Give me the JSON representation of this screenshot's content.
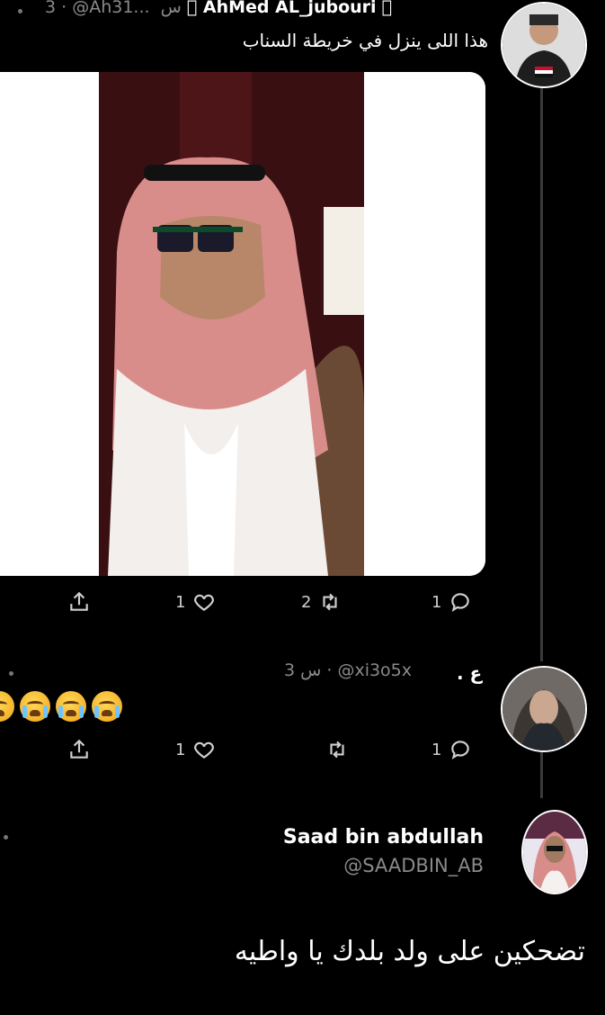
{
  "tweet1": {
    "time": "3 · @Ah31...  س",
    "apple_left": "",
    "name": "AhMed AL_jubouri",
    "apple_right": "",
    "text": "هذا اللى ينزل في خريطة السناب",
    "actions": {
      "share": "",
      "likes": "1",
      "retweets": "2",
      "replies": "1"
    }
  },
  "tweet2": {
    "time_handle": "س 3 · @xi3o5x",
    "name": "ع .",
    "emoji_count": 4,
    "actions": {
      "share": "",
      "likes": "1",
      "retweets": "",
      "replies": "1"
    }
  },
  "tweet3": {
    "name": "Saad bin abdullah",
    "handle": "@SAADBIN_AB",
    "text": "تضحكين على ولد بلدك يا واطيه"
  },
  "colors": {
    "background": "#000000",
    "muted": "#8a8a8a",
    "thread": "#3a3a3a"
  }
}
